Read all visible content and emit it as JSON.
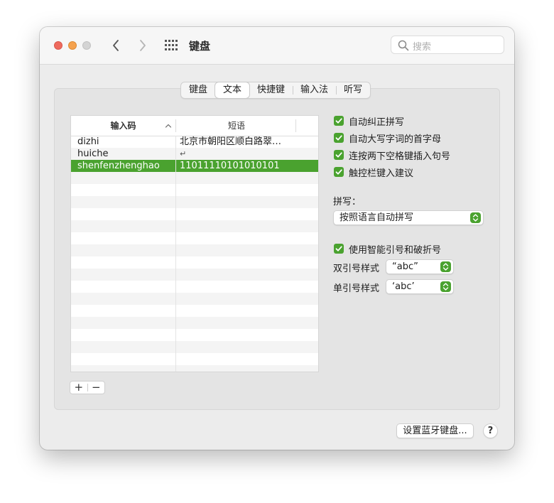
{
  "window": {
    "title": "键盘",
    "search_placeholder": "搜索"
  },
  "tabs": [
    {
      "label": "键盘",
      "active": false
    },
    {
      "label": "文本",
      "active": true
    },
    {
      "label": "快捷键",
      "active": false
    },
    {
      "label": "输入法",
      "active": false
    },
    {
      "label": "听写",
      "active": false
    }
  ],
  "table": {
    "columns": [
      "输入码",
      "短语"
    ],
    "rows": [
      {
        "code": "dizhi",
        "phrase": "北京市朝阳区顺白路翠…",
        "selected": false
      },
      {
        "code": "huiche",
        "phrase": "↵",
        "selected": false
      },
      {
        "code": "shenfenzhenghao",
        "phrase": "11011110101010101",
        "selected": true
      }
    ]
  },
  "controls": {
    "add_label": "+",
    "remove_label": "−"
  },
  "options": {
    "checkboxes": [
      {
        "label": "自动纠正拼写",
        "checked": true
      },
      {
        "label": "自动大写字词的首字母",
        "checked": true
      },
      {
        "label": "连按两下空格键插入句号",
        "checked": true
      },
      {
        "label": "触控栏键入建议",
        "checked": true
      }
    ],
    "spelling_label": "拼写：",
    "spelling_value": "按照语言自动拼写",
    "smart_quotes": {
      "label": "使用智能引号和破折号",
      "checked": true
    },
    "double_quote_label": "双引号样式",
    "double_quote_value": "“abc”",
    "single_quote_label": "单引号样式",
    "single_quote_value": "‘abc’"
  },
  "footer": {
    "bluetooth_button": "设置蓝牙键盘...",
    "help_label": "?"
  },
  "colors": {
    "accent": "#4aa22f"
  }
}
